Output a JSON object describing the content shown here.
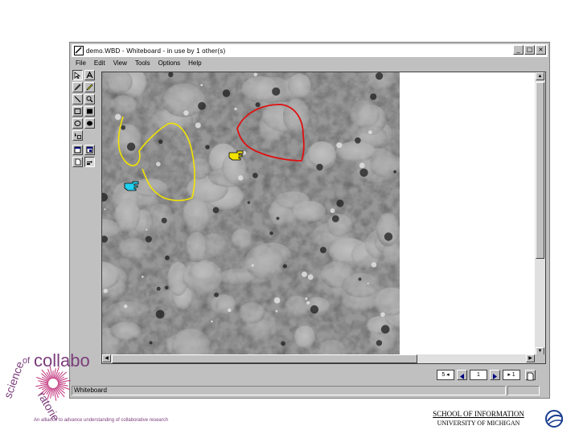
{
  "window": {
    "title": "demo.WBD - Whiteboard - in use by 1 other(s)",
    "controls": [
      "_",
      "□",
      "×"
    ]
  },
  "menu": [
    "File",
    "Edit",
    "View",
    "Tools",
    "Options",
    "Help"
  ],
  "tools": [
    "select-arrow",
    "text",
    "pen",
    "highlighter",
    "line",
    "zoom",
    "rectangle-outline",
    "rectangle-filled",
    "ellipse-outline",
    "ellipse-filled",
    "remote-pointer",
    "lock-contents",
    "synchronize",
    "insert-page",
    "remote-pointer-alt"
  ],
  "canvas": {
    "annotations": [
      {
        "type": "freehand",
        "color": "#f2e400"
      },
      {
        "type": "freehand",
        "color": "#e01010"
      }
    ],
    "pointers": [
      {
        "color": "#f2e400"
      },
      {
        "color": "#20d0f0"
      }
    ]
  },
  "page_controls": {
    "prev_label": "5 ◂",
    "page_number": "1",
    "next_label": "▸ 1"
  },
  "status": {
    "left": "Whiteboard"
  },
  "footer": {
    "logo_text": "science of collaboratories",
    "tagline": "An alliance to advance understanding of collaborative research",
    "school_line1": "SCHOOL OF INFORMATION",
    "school_line2": "UNIVERSITY OF MICHIGAN"
  }
}
